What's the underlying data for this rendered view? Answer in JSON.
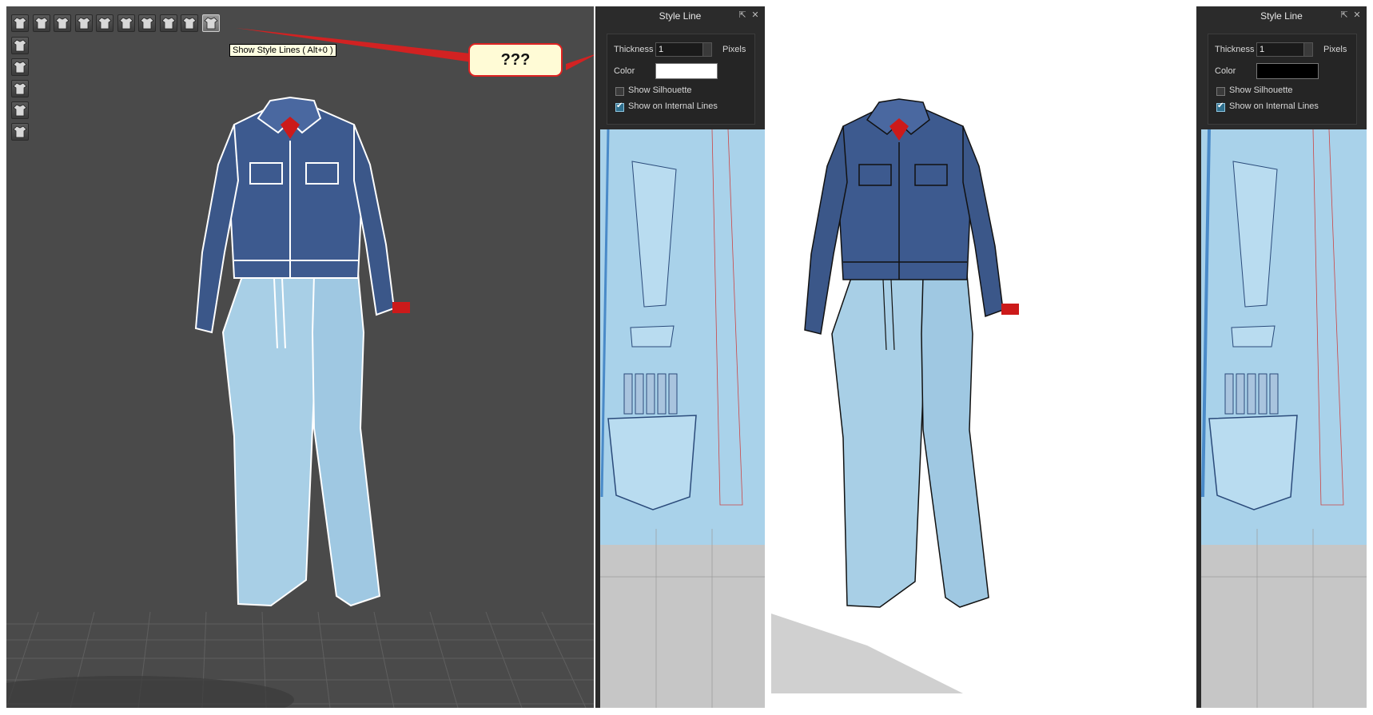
{
  "left_view": {
    "toolbar": {
      "icons": [
        "avatar-garment-icon",
        "garment-front-icon",
        "garment-back-icon",
        "garment-texture-icon",
        "garment-mesh-icon",
        "garment-fit-icon",
        "strain-map-icon",
        "pin-tool-icon",
        "garment-shaded-icon",
        "show-style-lines-icon"
      ],
      "side_icons": [
        "avatar-pose-icon",
        "avatar-icon",
        "fabric-icon",
        "brush-icon",
        "skin-icon"
      ]
    },
    "tooltip": "Show Style Lines ( Alt+0 )",
    "callout": "???",
    "colors": {
      "viewport": "#4a4a4a",
      "annotation": "#d22222",
      "style_line": "#ffffff"
    }
  },
  "panel_left": {
    "title": "Style Line",
    "thickness_label": "Thickness",
    "thickness_value": "1",
    "pixels_label": "Pixels",
    "color_label": "Color",
    "color_value": "#ffffff",
    "show_silhouette_label": "Show Silhouette",
    "show_silhouette": false,
    "show_internal_label": "Show on Internal Lines",
    "show_internal": true
  },
  "panel_right": {
    "title": "Style Line",
    "thickness_label": "Thickness",
    "thickness_value": "1",
    "pixels_label": "Pixels",
    "color_label": "Color",
    "color_value": "#000000",
    "show_silhouette_label": "Show Silhouette",
    "show_silhouette": false,
    "show_internal_label": "Show on Internal Lines",
    "show_internal": true
  },
  "right_view": {
    "colors": {
      "viewport": "#ffffff",
      "style_line": "#000000"
    }
  }
}
